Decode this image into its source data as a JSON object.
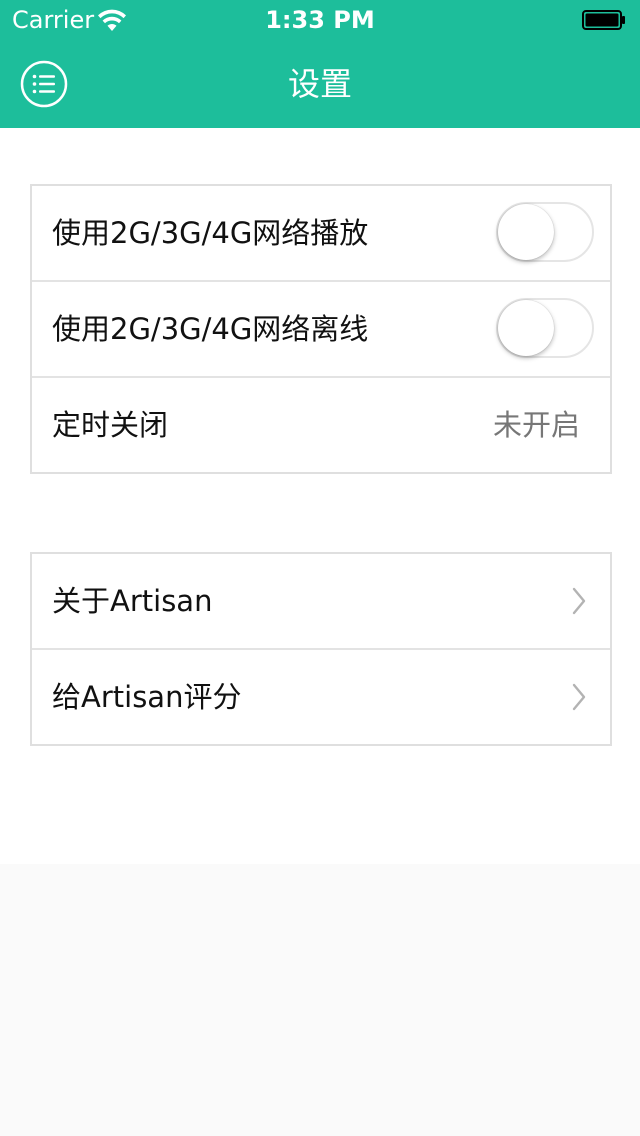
{
  "status_bar": {
    "carrier": "Carrier",
    "time": "1:33 PM",
    "wifi_icon": "wifi-icon",
    "battery_icon": "battery-icon"
  },
  "nav": {
    "title": "设置",
    "menu_icon": "list-menu-icon"
  },
  "settings_group": {
    "rows": [
      {
        "label": "使用2G/3G/4G网络播放",
        "toggle_on": false
      },
      {
        "label": "使用2G/3G/4G网络离线",
        "toggle_on": false
      },
      {
        "label": "定时关闭",
        "value": "未开启"
      }
    ]
  },
  "about_group": {
    "rows": [
      {
        "label": "关于Artisan",
        "icon": "chevron-right-icon"
      },
      {
        "label": "给Artisan评分",
        "icon": "chevron-right-icon"
      }
    ]
  },
  "colors": {
    "accent": "#1dbe9b",
    "background": "#fafafa",
    "separator": "#e3e3e3"
  }
}
